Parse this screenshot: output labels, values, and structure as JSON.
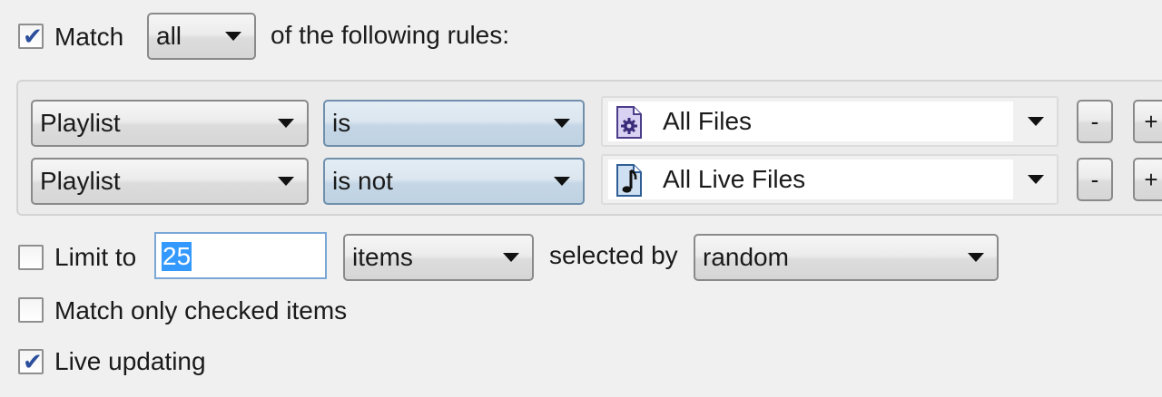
{
  "match": {
    "checked": true,
    "label": "Match",
    "mode": "all",
    "suffix": "of the following rules:"
  },
  "rules": [
    {
      "field": "Playlist",
      "operator": "is",
      "value": "All Files",
      "value_icon": "playlist-gear-icon",
      "remove_label": "-",
      "add_label": "+"
    },
    {
      "field": "Playlist",
      "operator": "is not",
      "value": "All Live Files",
      "value_icon": "music-note-file-icon",
      "remove_label": "-",
      "add_label": "+"
    }
  ],
  "limit": {
    "checked": false,
    "label": "Limit to",
    "amount": "25",
    "unit": "items",
    "selected_by_label": "selected by",
    "selected_by": "random"
  },
  "match_checked_only": {
    "checked": false,
    "label": "Match only checked items"
  },
  "live_updating": {
    "checked": true,
    "label": "Live updating"
  },
  "colors": {
    "selection": "#3399ff",
    "rule_field_bg": "#dce6ef",
    "accent_check": "#2b4f9c"
  }
}
